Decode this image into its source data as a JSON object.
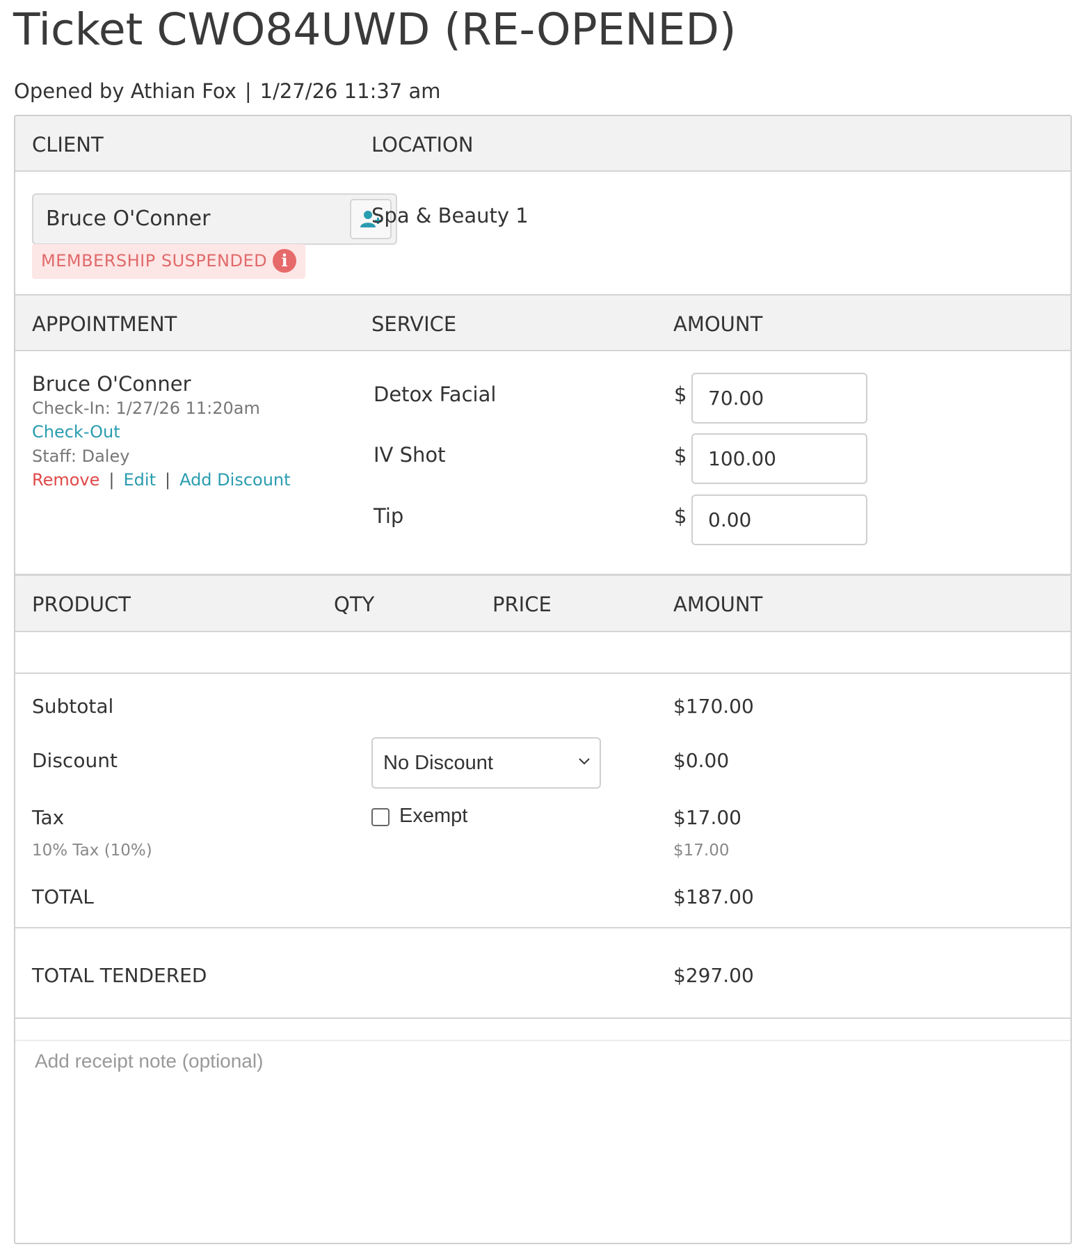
{
  "ticket": {
    "title": "Ticket CWO84UWD (RE-OPENED)",
    "opened_by": "Opened by Athian Fox",
    "opened_at": "1/27/26 11:37 am",
    "separator": "|"
  },
  "client_section": {
    "client_header": "CLIENT",
    "location_header": "LOCATION",
    "client_name": "Bruce O'Conner",
    "membership_badge": "MEMBERSHIP SUSPENDED",
    "info_glyph": "i",
    "location": "Spa & Beauty 1",
    "add_client_icon": "person-plus-icon"
  },
  "appointment_section": {
    "headers": {
      "appointment": "APPOINTMENT",
      "service": "SERVICE",
      "amount": "AMOUNT"
    },
    "client_name": "Bruce O'Conner",
    "check_in": "Check-In: 1/27/26 11:20am",
    "check_out_link": "Check-Out",
    "staff": "Staff: Daley",
    "actions": {
      "remove": "Remove",
      "edit": "Edit",
      "add_discount": "Add Discount",
      "separator": "|"
    },
    "lines": [
      {
        "service": "Detox Facial",
        "currency": "$",
        "amount": "70.00"
      },
      {
        "service": "IV Shot",
        "currency": "$",
        "amount": "100.00"
      },
      {
        "service": "Tip",
        "currency": "$",
        "amount": "0.00"
      }
    ]
  },
  "product_section": {
    "headers": {
      "product": "PRODUCT",
      "qty": "QTY",
      "price": "PRICE",
      "amount": "AMOUNT"
    }
  },
  "totals": {
    "subtotal_label": "Subtotal",
    "subtotal_value": "$170.00",
    "discount_label": "Discount",
    "discount_select": "No Discount",
    "discount_value": "$0.00",
    "tax_label": "Tax",
    "tax_exempt_label": "Exempt",
    "tax_exempt_checked": false,
    "tax_value": "$17.00",
    "tax_detail_label": "10% Tax (10%)",
    "tax_detail_value": "$17.00",
    "total_label": "TOTAL",
    "total_value": "$187.00",
    "tendered_label": "TOTAL TENDERED",
    "tendered_value": "$297.00"
  },
  "receipt_note": {
    "placeholder": "Add receipt note (optional)",
    "value": ""
  },
  "colors": {
    "link": "#2a9cb0",
    "danger": "#e04848",
    "badge_bg": "#fde6e6",
    "badge_text": "#e06a6a"
  }
}
